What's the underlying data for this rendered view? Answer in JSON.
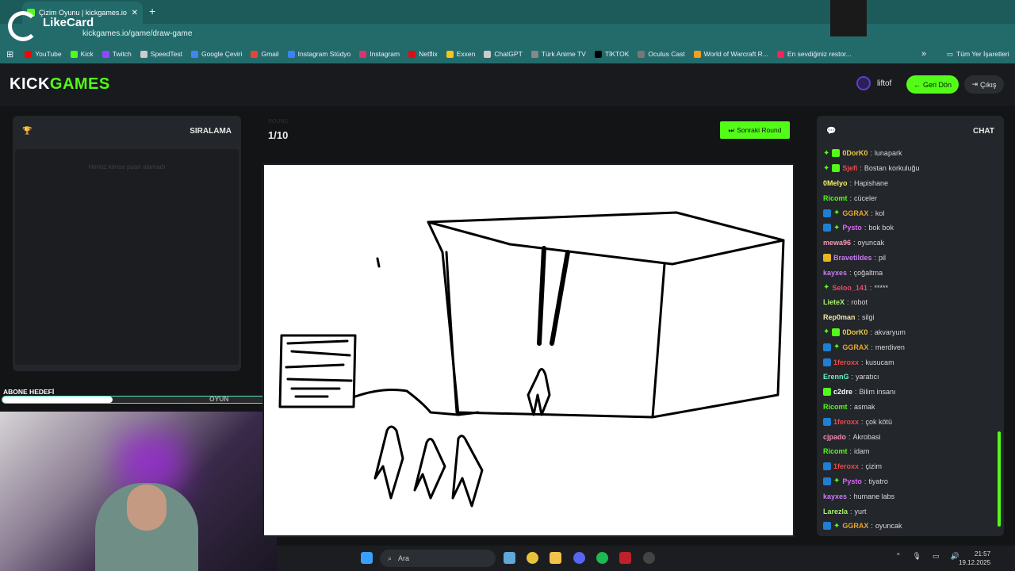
{
  "browser": {
    "tab_title": "Çizim Oyunu | kickgames.io",
    "url": "kickgames.io/game/draw-game",
    "overlay_brand": "LikeCard"
  },
  "bookmarks": [
    {
      "label": "YouTube",
      "color": "#ff0000"
    },
    {
      "label": "Kick",
      "color": "#53fc18"
    },
    {
      "label": "Twitch",
      "color": "#9146ff"
    },
    {
      "label": "SpeedTest",
      "color": "#cccccc"
    },
    {
      "label": "Google Çeviri",
      "color": "#4285f4"
    },
    {
      "label": "Gmail",
      "color": "#ea4335"
    },
    {
      "label": "Instagram Stüdyo",
      "color": "#3b82f6"
    },
    {
      "label": "Instagram",
      "color": "#e1306c"
    },
    {
      "label": "Netflix",
      "color": "#e50914"
    },
    {
      "label": "Exxen",
      "color": "#f5c518"
    },
    {
      "label": "ChatGPT",
      "color": "#cccccc"
    },
    {
      "label": "Türk Anime TV",
      "color": "#888888"
    },
    {
      "label": "TİKTOK",
      "color": "#000000"
    },
    {
      "label": "Oculus Cast",
      "color": "#777777"
    },
    {
      "label": "World of Warcraft R...",
      "color": "#f0a020"
    },
    {
      "label": "En sevdiğiniz restor...",
      "color": "#ff1f5a"
    }
  ],
  "bookmarks_all": "Tüm Yer İşaretleri",
  "header": {
    "logo_a": "KICK",
    "logo_b": "GAMES",
    "username": "liftof",
    "back_label": "Geri Dön",
    "exit_label": "Çıkış"
  },
  "leaderboard": {
    "title": "SIRALAMA",
    "empty_text": "Henüz kimse puan alamadı"
  },
  "sub_goal": {
    "label": "ABONE HEDEFİ",
    "progress": 0.4,
    "tag": "OYUN"
  },
  "game": {
    "round_label": "ROUND",
    "round": "1/10",
    "next_label": "Sonraki Round"
  },
  "chat": {
    "title": "CHAT",
    "messages": [
      {
        "user": "0DorK0",
        "color": "#e8c84a",
        "badges": [
          "spark",
          "gift"
        ],
        "text": "lunapark"
      },
      {
        "user": "Sjefi",
        "color": "#e84a4a",
        "badges": [
          "spark",
          "gift"
        ],
        "text": "Bostan korkuluğu"
      },
      {
        "user": "0Melyo",
        "color": "#f2f26a",
        "badges": [],
        "text": "Hapishane"
      },
      {
        "user": "Ricomt",
        "color": "#53fc18",
        "badges": [],
        "text": "cüceler"
      },
      {
        "user": "GGRAX",
        "color": "#e8a62a",
        "badges": [
          "sub",
          "spark"
        ],
        "text": "kol"
      },
      {
        "user": "Pysto",
        "color": "#d86af2",
        "badges": [
          "sub",
          "spark"
        ],
        "text": "bok bok"
      },
      {
        "user": "mewa96",
        "color": "#f29ab0",
        "badges": [],
        "text": "oyuncak"
      },
      {
        "user": "Bravetildes",
        "color": "#c97af2",
        "badges": [
          "vip"
        ],
        "text": "pil"
      },
      {
        "user": "kayxes",
        "color": "#c97af2",
        "badges": [],
        "text": "çoğaltma"
      },
      {
        "user": "Seloo_141",
        "color": "#e84a6a",
        "badges": [
          "spark"
        ],
        "text": "*****"
      },
      {
        "user": "LieteX",
        "color": "#a8f26a",
        "badges": [],
        "text": "robot"
      },
      {
        "user": "Rep0man",
        "color": "#f2e4a0",
        "badges": [],
        "text": "silgi"
      },
      {
        "user": "0DorK0",
        "color": "#e8c84a",
        "badges": [
          "spark",
          "gift"
        ],
        "text": "akvaryum"
      },
      {
        "user": "GGRAX",
        "color": "#e8a62a",
        "badges": [
          "sub",
          "spark"
        ],
        "text": "merdiven"
      },
      {
        "user": "1feroxx",
        "color": "#e84a4a",
        "badges": [
          "sub"
        ],
        "text": "kusucam"
      },
      {
        "user": "ErennG",
        "color": "#6af2c0",
        "badges": [],
        "text": "yaratıcı"
      },
      {
        "user": "c2dre",
        "color": "#ffffff",
        "badges": [
          "gift"
        ],
        "text": "Bilim insanı"
      },
      {
        "user": "Ricomt",
        "color": "#53fc18",
        "badges": [],
        "text": "asmak"
      },
      {
        "user": "1feroxx",
        "color": "#e84a4a",
        "badges": [
          "sub"
        ],
        "text": "çok kötü"
      },
      {
        "user": "cjpado",
        "color": "#f28ab0",
        "badges": [],
        "text": "Akrobasi"
      },
      {
        "user": "Ricomt",
        "color": "#53fc18",
        "badges": [],
        "text": "idam"
      },
      {
        "user": "1feroxx",
        "color": "#e84a4a",
        "badges": [
          "sub"
        ],
        "text": "çizim"
      },
      {
        "user": "Pysto",
        "color": "#d86af2",
        "badges": [
          "sub",
          "spark"
        ],
        "text": "tiyatro"
      },
      {
        "user": "kayxes",
        "color": "#c97af2",
        "badges": [],
        "text": "humane labs"
      },
      {
        "user": "Larezla",
        "color": "#a8f26a",
        "badges": [],
        "text": "yurt"
      },
      {
        "user": "GGRAX",
        "color": "#e8a62a",
        "badges": [
          "sub",
          "spark"
        ],
        "text": "oyuncak"
      }
    ]
  },
  "taskbar": {
    "search_placeholder": "Ara",
    "time": "21:57",
    "date": "19.12.2025"
  }
}
